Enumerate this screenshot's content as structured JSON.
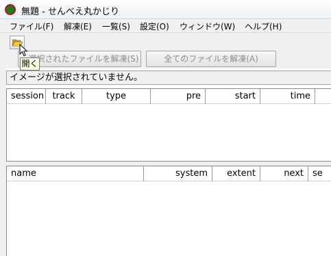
{
  "window": {
    "title": "無題 - せんべえ丸かじり"
  },
  "menu": [
    "ファイル(F)",
    "解凍(E)",
    "一覧(S)",
    "設定(O)",
    "ウィンドウ(W)",
    "ヘルプ(H)"
  ],
  "toolbar": {
    "open_icon": "folder-open-icon",
    "tooltip": "開く",
    "extract_selected_label": "選択されたファイルを解凍(S)",
    "extract_all_label": "全てのファイルを解凍(A)"
  },
  "status": {
    "message": "イメージが選択されていません。"
  },
  "track_list": {
    "columns": [
      "session",
      "track",
      "type",
      "pre",
      "start",
      "time"
    ]
  },
  "file_list": {
    "columns": [
      "name",
      "system",
      "extent",
      "next",
      "se"
    ]
  },
  "colors": {
    "app_icon_fill": "#1d7a1d",
    "app_icon_ring": "#b5121b",
    "tooltip_bg": "#ffffe1"
  }
}
